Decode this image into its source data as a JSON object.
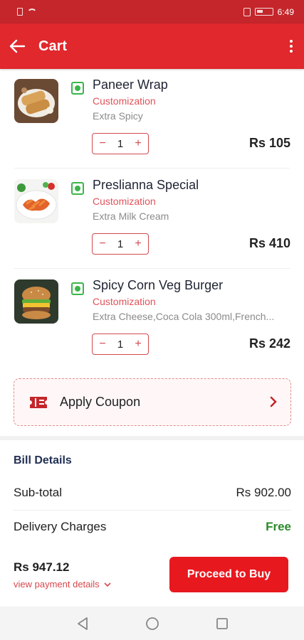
{
  "status_bar": {
    "time": "6:49"
  },
  "app_bar": {
    "title": "Cart"
  },
  "items": [
    {
      "name": "Paneer Wrap",
      "customization_label": "Customization",
      "extras": "Extra Spicy",
      "quantity": "1",
      "price": "Rs 105",
      "image_icon": "wrap-food-image"
    },
    {
      "name": "Preslianna Special",
      "customization_label": "Customization",
      "extras": "Extra Milk Cream",
      "quantity": "1",
      "price": "Rs 410",
      "image_icon": "pasta-food-image"
    },
    {
      "name": "Spicy Corn Veg Burger",
      "customization_label": "Customization",
      "extras": "Extra Cheese,Coca Cola 300ml,French...",
      "quantity": "1",
      "price": "Rs 242",
      "image_icon": "burger-food-image"
    }
  ],
  "stepper": {
    "minus": "−",
    "plus": "+"
  },
  "coupon": {
    "label": "Apply Coupon"
  },
  "bill": {
    "title": "Bill Details",
    "subtotal_label": "Sub-total",
    "subtotal_value": "Rs 902.00",
    "delivery_label": "Delivery Charges",
    "delivery_value": "Free"
  },
  "footer": {
    "total": "Rs 947.12",
    "view_details": "view payment details",
    "proceed_label": "Proceed to Buy"
  },
  "colors": {
    "brand": "#e0282d",
    "veg": "#3bb54a",
    "free": "#2a8a2a"
  }
}
